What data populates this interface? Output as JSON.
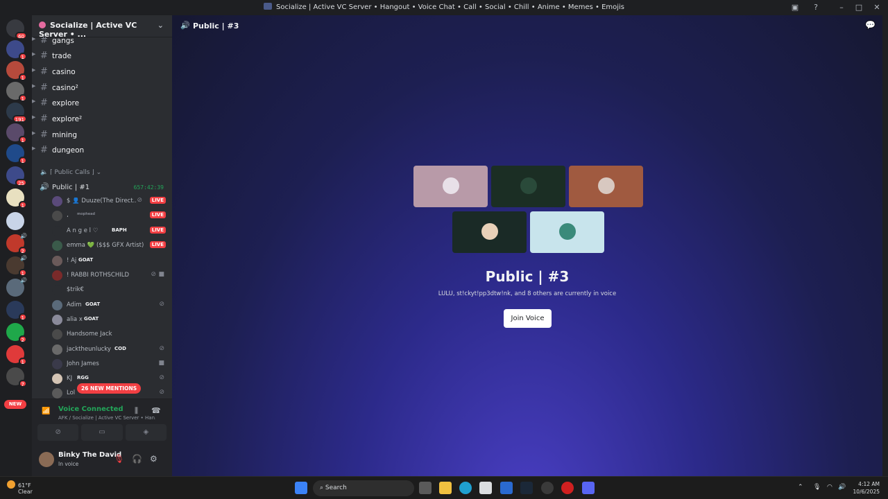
{
  "window": {
    "title": "Socialize | Active VC Server • Hangout • Voice Chat • Call • Social • Chill • Anime • Memes • Emojis"
  },
  "rail": {
    "badges": [
      "60",
      "1",
      "1",
      "1",
      "191",
      "1",
      "1",
      "25",
      "1",
      "2",
      "1",
      "1",
      "2",
      "1",
      "7"
    ],
    "new_label": "NEW"
  },
  "server": {
    "name": "Socialize | Active VC Server • ..."
  },
  "channels": [
    {
      "name": "gangs"
    },
    {
      "name": "trade"
    },
    {
      "name": "casino"
    },
    {
      "name": "casino²"
    },
    {
      "name": "explore"
    },
    {
      "name": "explore²"
    },
    {
      "name": "mining"
    },
    {
      "name": "dungeon"
    }
  ],
  "voice_category": "⌈ Public Calls ⌋",
  "voice_channel": {
    "name": "Public | #1",
    "timer": "657:42:39"
  },
  "voice_users": [
    {
      "name": "$ 👤 Duuze(The Direct...",
      "tag": "",
      "live": "LIVE"
    },
    {
      "name": "، ",
      "tag": "mophead",
      "live": "LIVE"
    },
    {
      "name": "A n g e l ♡",
      "tag": "BAPH",
      "live": "LIVE"
    },
    {
      "name": "emma 💚 ($$$ GFX Artist)",
      "tag": "",
      "live": "LIVE"
    },
    {
      "name": "! Aj",
      "tag": "GOAT",
      "live": ""
    },
    {
      "name": "! RABBI ROTHSCHILD",
      "tag": "",
      "live": ""
    },
    {
      "name": "$trik€",
      "tag": "",
      "live": ""
    },
    {
      "name": "Adim",
      "tag": "GOAT",
      "live": ""
    },
    {
      "name": "alia x",
      "tag": "GOAT",
      "live": ""
    },
    {
      "name": "Handsome Jack",
      "tag": "",
      "live": ""
    },
    {
      "name": "jacktheunlucky",
      "tag": "COD",
      "live": ""
    },
    {
      "name": "John James",
      "tag": "",
      "live": ""
    },
    {
      "name": "KJ",
      "tag": "RGG",
      "live": ""
    },
    {
      "name": "Lol",
      "tag": "",
      "live": ""
    }
  ],
  "mentions_pill": "26 NEW MENTIONS",
  "voice_panel": {
    "status": "Voice Connected",
    "path": "AFK / Socialize | Active VC Server • Han..."
  },
  "user": {
    "name": "Binky The David",
    "status": "In voice"
  },
  "main": {
    "header_name": "Public | #3",
    "title": "Public | #3",
    "subtitle": "LULU, st!ckyt!pp3dtw!nk, and 8 others are currently in voice",
    "join_label": "Join Voice"
  },
  "taskbar": {
    "temp": "61°F",
    "weather": "Clear",
    "search": "Search",
    "time": "4:12 AM",
    "date": "10/6/2025"
  },
  "colors": {
    "accent_green": "#23a559",
    "live_red": "#f23f43",
    "blurple": "#4a3fc5"
  }
}
